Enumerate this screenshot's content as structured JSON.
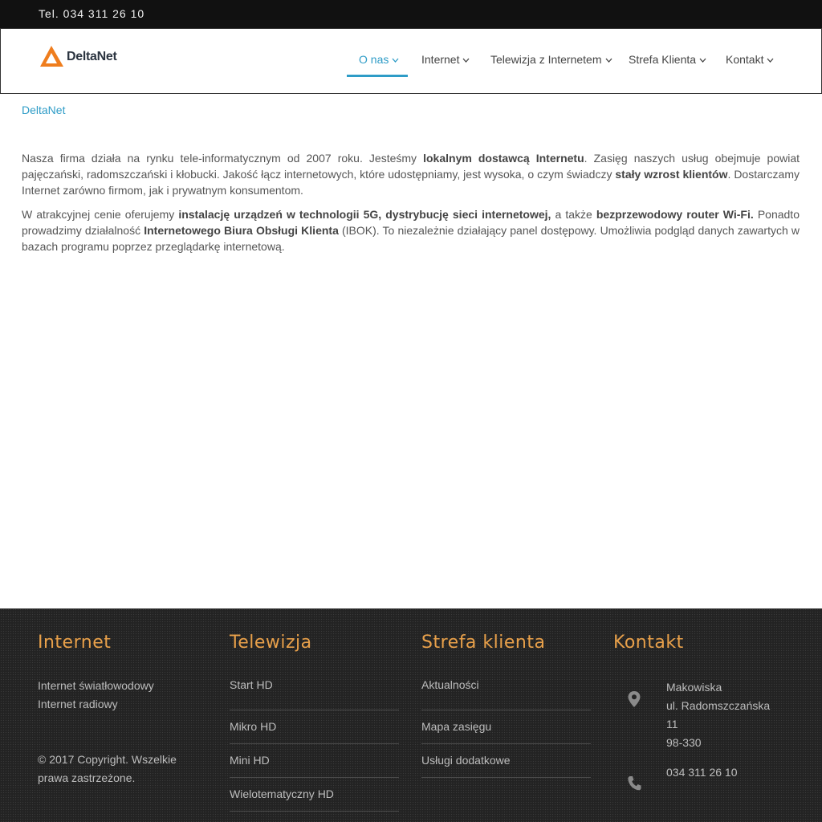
{
  "topbar": {
    "phone": "Tel. 034 311 26 10"
  },
  "logo": {
    "text": "DeltaNet"
  },
  "nav": {
    "items": [
      {
        "label": "O nas"
      },
      {
        "label": "Internet"
      },
      {
        "label": "Telewizja z Internetem"
      },
      {
        "label": "Strefa Klienta"
      },
      {
        "label": "Kontakt"
      }
    ],
    "active_color": "#2e9cc7"
  },
  "breadcrumb": "DeltaNet",
  "content": {
    "p1": [
      "Nasza firma działa na rynku tele-informatycznym od 2007 roku. Jesteśmy ",
      "lokalnym dostawcą Internetu",
      ". Zasięg naszych usług obejmuje powiat pajęczański, radomszczański i kłobucki. Jakość łącz internetowych, które udostępniamy, jest wysoka, o czym świadczy ",
      "stały wzrost klientów",
      ". Dostarczamy Internet zarówno firmom, jak i prywatnym konsumentom."
    ],
    "p2": [
      "W atrakcyjnej cenie oferujemy ",
      "instalację urządzeń w technologii 5G, dystrybucję sieci internetowej,",
      " a także ",
      "bezprzewodowy router Wi-Fi.",
      " Ponadto prowadzimy działalność ",
      "Internetowego Biura Obsługi Klienta",
      " (IBOK). To niezależnie działający panel dostępowy. Umożliwia podgląd danych zawartych w bazach programu poprzez przeglądarkę internetową."
    ]
  },
  "footer": {
    "accent_color": "#e8a04a",
    "internet": {
      "title": "Internet",
      "links": [
        "Internet światłowodowy",
        "Internet radiowy"
      ],
      "copyright": [
        "© 2017 Copyright. Wszelkie",
        "prawa zastrzeżone."
      ]
    },
    "tv": {
      "title": "Telewizja",
      "links": [
        "Start HD",
        "Mikro HD",
        "Mini HD",
        "Wielotematyczny HD"
      ]
    },
    "client": {
      "title": "Strefa klienta",
      "links": [
        "Aktualności",
        "Mapa zasięgu",
        "Usługi dodatkowe"
      ]
    },
    "contact": {
      "title": "Kontakt",
      "address": [
        "Makowiska",
        "ul. Radomszczańska",
        "11",
        "98-330"
      ],
      "phone": "034 311 26 10",
      "icons": [
        "map-pin-icon",
        "phone-icon"
      ]
    }
  }
}
